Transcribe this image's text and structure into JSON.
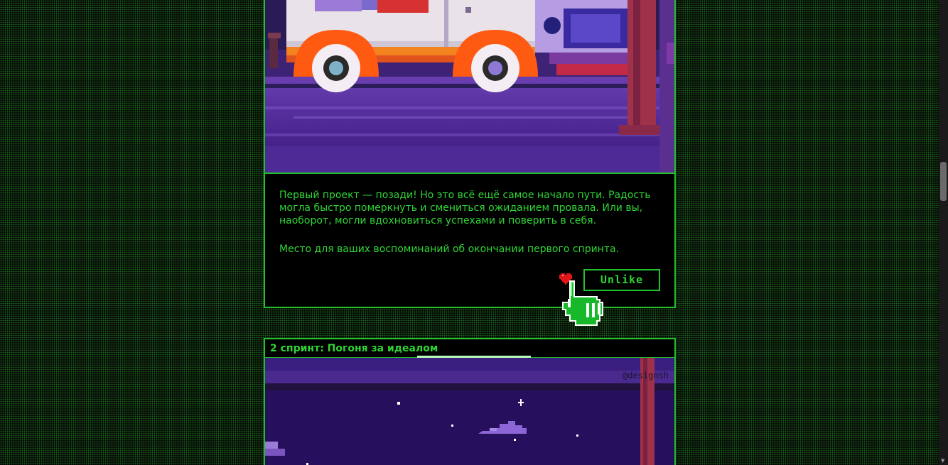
{
  "colors": {
    "accent": "#2fd435",
    "border": "#22c02a",
    "heart": "#e0161b",
    "background": "#050805"
  },
  "post1": {
    "image_alt": "pixel art van on purple street",
    "paragraph1": "Первый проект — позади! Но это всё ещё самое начало пути. Радость могла быстро померкнуть и смениться ожиданием провала. Или вы, наоборот, могли вдохновиться успехами и поверить в себя.",
    "paragraph2": "Место для ваших воспоминаний об окончании первого спринта.",
    "like_icon": "heart-icon",
    "like_button": "Unlike",
    "cursor_icon": "pixel-hand-cursor-icon"
  },
  "post2": {
    "title": "2 спринт: Погоня за идеалом",
    "image_alt": "pixel art night sky with stars",
    "credit": "@designsh"
  }
}
